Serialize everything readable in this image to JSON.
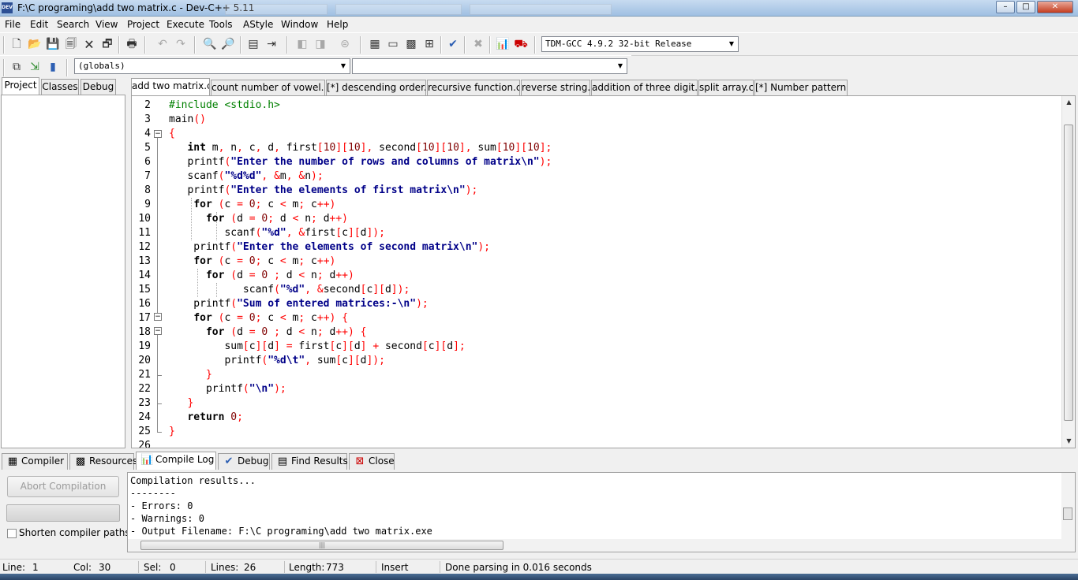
{
  "window": {
    "title": "F:\\C programing\\add two matrix.c - Dev-C++ 5.11",
    "icon_label": "DEV"
  },
  "menu": [
    "File",
    "Edit",
    "Search",
    "View",
    "Project",
    "Execute",
    "Tools",
    "AStyle",
    "Window",
    "Help"
  ],
  "toolbar": {
    "compiler_select": "TDM-GCC 4.9.2 32-bit Release",
    "scope_select": "(globals)",
    "member_select": ""
  },
  "left_tabs": [
    "Project",
    "Classes",
    "Debug"
  ],
  "file_tabs": [
    "add two matrix.c",
    "count number of vowel.c",
    "[*] descending order.c",
    "recursive function.c",
    "reverse string.c",
    "addition of three digit.c",
    "split array.c",
    "[*] Number pattern.c"
  ],
  "editor": {
    "line_numbers": [
      "2",
      "3",
      "4",
      "5",
      "6",
      "7",
      "8",
      "9",
      "10",
      "11",
      "12",
      "13",
      "14",
      "15",
      "16",
      "17",
      "18",
      "19",
      "20",
      "21",
      "22",
      "23",
      "24",
      "25",
      "26"
    ]
  },
  "bottom_tabs": [
    "Compiler",
    "Resources",
    "Compile Log",
    "Debug",
    "Find Results",
    "Close"
  ],
  "compile_panel": {
    "abort_label": "Abort Compilation",
    "shorten_label": "Shorten compiler paths",
    "log": [
      "Compilation results...",
      "--------",
      "- Errors: 0",
      "- Warnings: 0",
      "- Output Filename: F:\\C programing\\add two matrix.exe"
    ]
  },
  "status": {
    "line_label": "Line:",
    "line_value": "1",
    "col_label": "Col:",
    "col_value": "30",
    "sel_label": "Sel:",
    "sel_value": "0",
    "lines_label": "Lines:",
    "lines_value": "26",
    "length_label": "Length:",
    "length_value": "773",
    "mode": "Insert",
    "message": "Done parsing in 0.016 seconds"
  }
}
